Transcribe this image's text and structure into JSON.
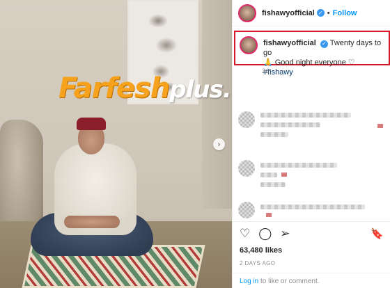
{
  "header": {
    "username": "fishawyofficial",
    "separator": "•",
    "follow_label": "Follow"
  },
  "caption": {
    "username": "fishawyofficial",
    "text": "Twenty days to go",
    "line2": "🙏 Good night everyone ♡",
    "hashtag": "#fishawy",
    "age": "2d"
  },
  "photo": {
    "watermark_part1": "Farfesh",
    "watermark_part2": "plus.com"
  },
  "post": {
    "likes": "63,480 likes",
    "date": "2 DAYS AGO"
  },
  "login": {
    "link": "Log in",
    "rest": "to like or comment."
  },
  "icons": {
    "next": "›",
    "heart": "♡",
    "comment": "◯",
    "share": "➢",
    "bookmark": "🔖",
    "verified": "✓"
  },
  "colors": {
    "accent": "#0095f6",
    "highlight_border": "#d6162b",
    "watermark": "#f6a21c"
  }
}
